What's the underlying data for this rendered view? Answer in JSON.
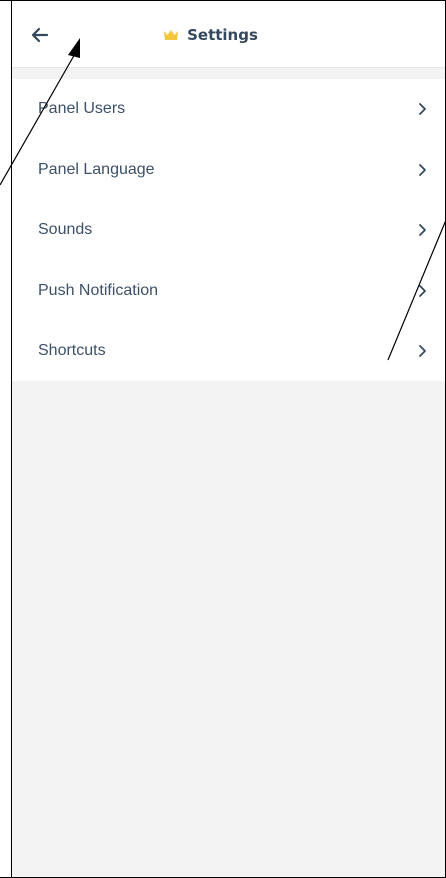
{
  "header": {
    "back_icon": "arrow-left-icon",
    "crown_icon": "crown-icon",
    "title": "Settings"
  },
  "menu": {
    "items": [
      {
        "label": "Panel Users",
        "icon": "chevron-right-icon"
      },
      {
        "label": "Panel Language",
        "icon": "chevron-right-icon"
      },
      {
        "label": "Sounds",
        "icon": "chevron-right-icon"
      },
      {
        "label": "Push Notification",
        "icon": "chevron-right-icon"
      },
      {
        "label": "Shortcuts",
        "icon": "chevron-right-icon"
      }
    ]
  },
  "colors": {
    "title": "#34495e",
    "menu_text": "#3c5068",
    "crown": "#f5c542",
    "background": "#f3f3f3",
    "card": "#ffffff"
  }
}
